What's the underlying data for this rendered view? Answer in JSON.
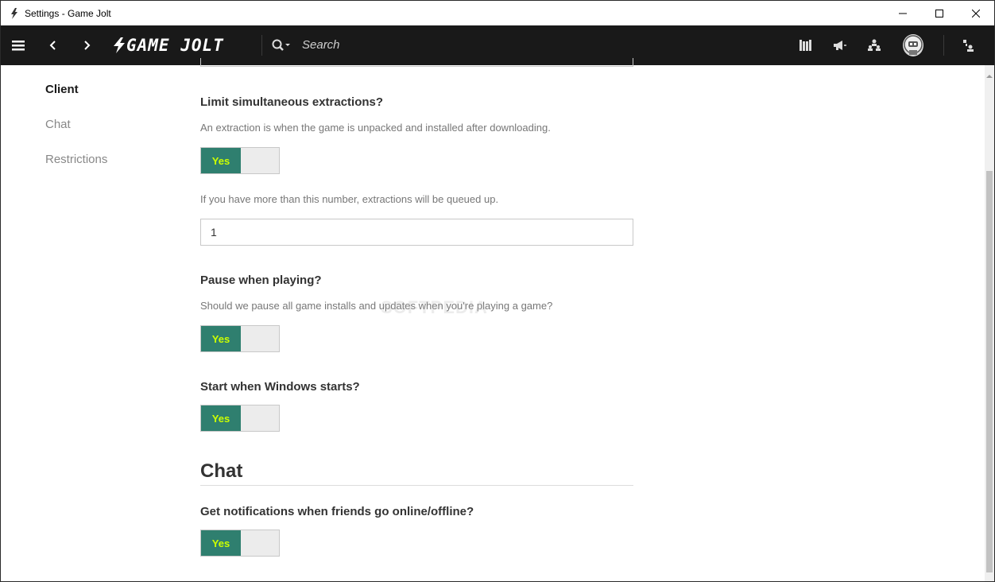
{
  "window": {
    "title": "Settings - Game Jolt",
    "controls": [
      "minimize-icon",
      "maximize-icon",
      "close-icon"
    ]
  },
  "navbar": {
    "logo_text": "GAME JOLT",
    "search_placeholder": "Search",
    "icons": [
      "menu-icon",
      "back-chevron-icon",
      "forward-chevron-icon",
      "search-icon",
      "library-icon",
      "announcements-icon",
      "friends-icon",
      "avatar",
      "connection-icon"
    ]
  },
  "sidebar": {
    "items": [
      {
        "label": "Client",
        "active": true
      },
      {
        "label": "Chat",
        "active": false
      },
      {
        "label": "Restrictions",
        "active": false
      }
    ]
  },
  "content": {
    "extractions": {
      "question": "Limit simultaneous extractions?",
      "description": "An extraction is when the game is unpacked and installed after downloading.",
      "toggle": "Yes",
      "queue_note": "If you have more than this number, extractions will be queued up.",
      "value": "1"
    },
    "pause": {
      "question": "Pause when playing?",
      "description": "Should we pause all game installs and updates when you're playing a game?",
      "toggle": "Yes"
    },
    "startup": {
      "question": "Start when Windows starts?",
      "toggle": "Yes"
    },
    "chat_section": {
      "heading": "Chat",
      "question": "Get notifications when friends go online/offline?",
      "toggle": "Yes"
    }
  },
  "watermark": "SOFTPEDIA",
  "colors": {
    "navbar_bg": "#191919",
    "toggle_on_bg": "#2f7f6f",
    "toggle_on_text": "#ccff00",
    "toggle_off_bg": "#ececec"
  }
}
